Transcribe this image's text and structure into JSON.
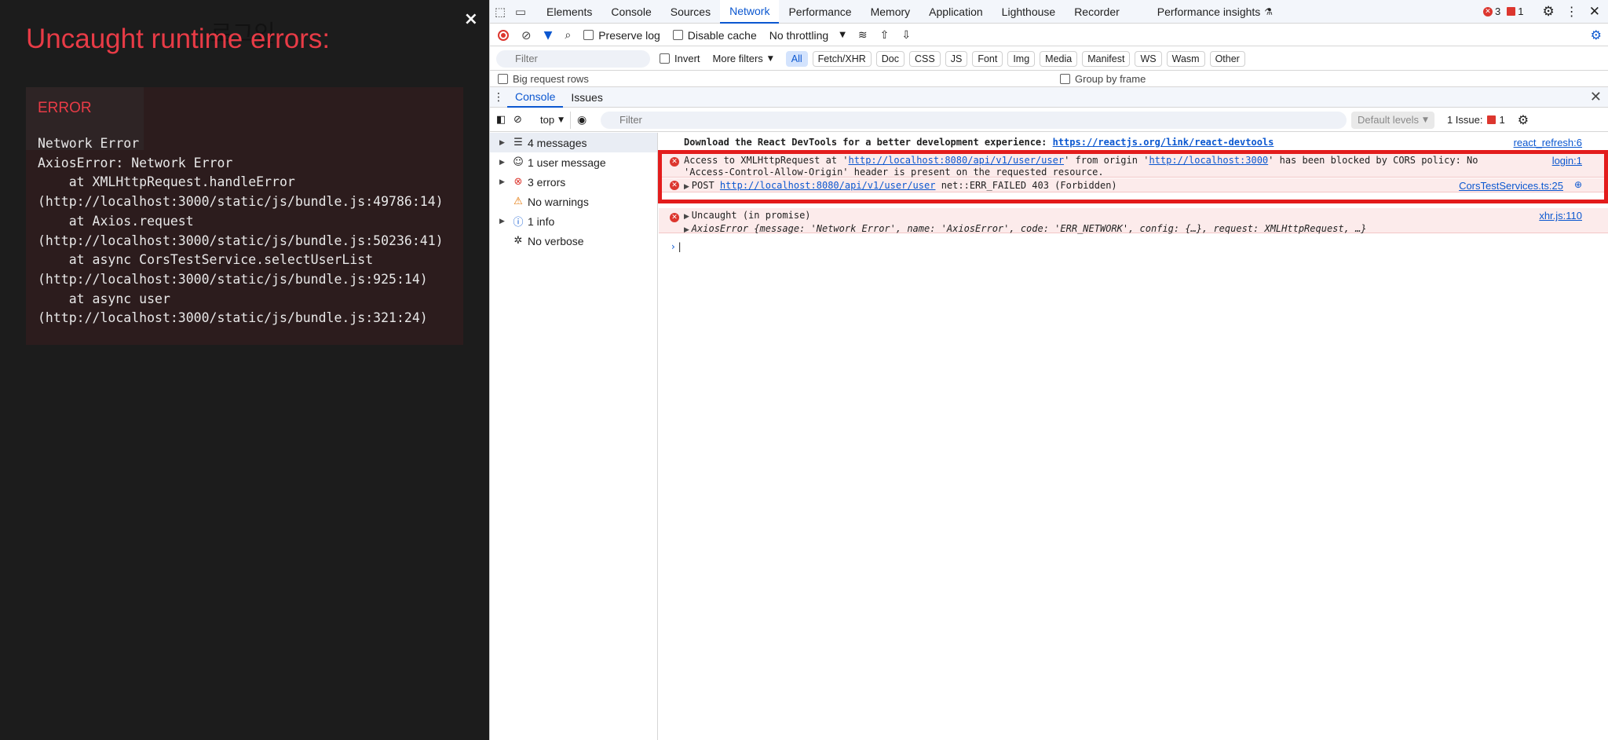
{
  "overlay": {
    "bg_title": "로그인",
    "close_glyph": "×",
    "title": "Uncaught runtime errors:",
    "error_label": "ERROR",
    "stack": "Network Error\nAxiosError: Network Error\n    at XMLHttpRequest.handleError\n(http://localhost:3000/static/js/bundle.js:49786:14)\n    at Axios.request\n(http://localhost:3000/static/js/bundle.js:50236:41)\n    at async CorsTestService.selectUserList\n(http://localhost:3000/static/js/bundle.js:925:14)\n    at async user\n(http://localhost:3000/static/js/bundle.js:321:24)"
  },
  "devtools": {
    "tabs": [
      "Elements",
      "Console",
      "Sources",
      "Network",
      "Performance",
      "Memory",
      "Application",
      "Lighthouse",
      "Recorder",
      "Performance insights"
    ],
    "active_tab": "Network",
    "error_count": "3",
    "issue_count": "1",
    "network_toolbar": {
      "preserve_log": "Preserve log",
      "disable_cache": "Disable cache",
      "throttling": "No throttling"
    },
    "network_filter": {
      "placeholder": "Filter",
      "invert": "Invert",
      "more_filters": "More filters",
      "types": [
        "All",
        "Fetch/XHR",
        "Doc",
        "CSS",
        "JS",
        "Font",
        "Img",
        "Media",
        "Manifest",
        "WS",
        "Wasm",
        "Other"
      ],
      "big_request_rows": "Big request rows",
      "group_by_frame": "Group by frame"
    },
    "drawer_tabs": [
      "Console",
      "Issues"
    ],
    "console_toolbar": {
      "context": "top",
      "filter_placeholder": "Filter",
      "levels": "Default levels",
      "issues_label": "1 Issue:",
      "issues_count": "1"
    },
    "sidebar": [
      {
        "label": "4 messages",
        "icon": "list-icon"
      },
      {
        "label": "1 user message",
        "icon": "user-icon"
      },
      {
        "label": "3 errors",
        "icon": "error-icon"
      },
      {
        "label": "No warnings",
        "icon": "warning-icon"
      },
      {
        "label": "1 info",
        "icon": "info-icon"
      },
      {
        "label": "No verbose",
        "icon": "bug-icon"
      }
    ],
    "messages": {
      "m1_text": "Download the React DevTools for a better development experience: ",
      "m1_link": "https://reactjs.org/link/react-devtools",
      "m1_src": "react_refresh:6",
      "m2_a": "Access to XMLHttpRequest at '",
      "m2_link1": "http://localhost:8080/api/v1/user/user",
      "m2_b": "' from origin '",
      "m2_link2": "http://localhost:3000",
      "m2_c": "' has been blocked by CORS policy: No",
      "m2_line2": "'Access-Control-Allow-Origin' header is present on the requested resource.",
      "m2_src": "login:1",
      "m3_a": "POST ",
      "m3_link": "http://localhost:8080/api/v1/user/user",
      "m3_b": " net::ERR_FAILED 403 (Forbidden)",
      "m3_src": "CorsTestServices.ts:25",
      "m4_a": "Uncaught (in promise)",
      "m4_src": "xhr.js:110",
      "m4_obj": "AxiosError {message: 'Network Error', name: 'AxiosError', code: 'ERR_NETWORK', config: {…}, request: XMLHttpRequest, …}"
    }
  }
}
